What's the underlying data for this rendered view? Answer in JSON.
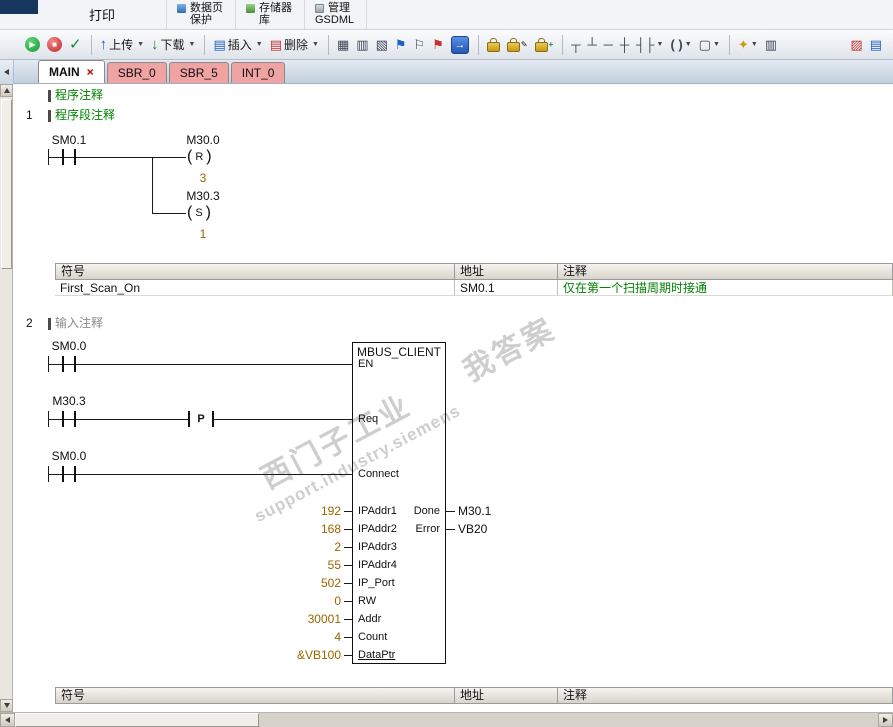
{
  "ribbon": {
    "print": "打印",
    "data_page": "数据页",
    "protect": "保护",
    "memory": "存储器",
    "library": "库",
    "manage": "管理",
    "gsdml": "GSDML"
  },
  "toolbar": {
    "upload": "上传",
    "download": "下载",
    "insert": "插入",
    "delete": "删除"
  },
  "icons": {
    "run": "▶",
    "stop": "■",
    "compile": "✓",
    "up_arrow": "↑",
    "down_arrow": "↓",
    "caret": "▼",
    "grid": "▤",
    "grid2": "▦",
    "grid3": "▥",
    "apply": "▧",
    "flag": "⚑",
    "flag_off": "⚐",
    "status_arrow": "→",
    "branch_down": "┬",
    "branch_up": "┴",
    "line_h": "─",
    "cross": "┼",
    "contact": "┤├",
    "coil": "( )",
    "box": "▢",
    "wand": "✦",
    "pencil": "✎",
    "plus": "+",
    "chart": "▨",
    "close_x": "×",
    "scroll_up": "▲",
    "scroll_left": "◄"
  },
  "tabs": [
    {
      "label": "MAIN",
      "close": "×"
    },
    {
      "label": "SBR_0"
    },
    {
      "label": "SBR_5"
    },
    {
      "label": "INT_0"
    }
  ],
  "editor": {
    "program_comment": "程序注释",
    "net1": {
      "num": "1",
      "comment": "程序段注释",
      "contact": "SM0.1",
      "coil1": {
        "label": "M30.0",
        "fn": "R",
        "n": "3"
      },
      "coil2": {
        "label": "M30.3",
        "fn": "S",
        "n": "1"
      }
    },
    "table1": {
      "h": {
        "sym": "符号",
        "addr": "地址",
        "cmt": "注释"
      },
      "row": {
        "sym": "First_Scan_On",
        "addr": "SM0.1",
        "cmt": "仅在第一个扫描周期时接通"
      }
    },
    "net2": {
      "num": "2",
      "comment": "输入注释",
      "rung1": "SM0.0",
      "rung2": "M30.3",
      "p": "P",
      "rung3": "SM0.0",
      "block": {
        "title": "MBUS_CLIENT",
        "en": "EN",
        "req": "Req",
        "connect": "Connect",
        "in": [
          {
            "v": "192",
            "n": "IPAddr1"
          },
          {
            "v": "168",
            "n": "IPAddr2"
          },
          {
            "v": "2",
            "n": "IPAddr3"
          },
          {
            "v": "55",
            "n": "IPAddr4"
          },
          {
            "v": "502",
            "n": "IP_Port"
          },
          {
            "v": "0",
            "n": "RW"
          },
          {
            "v": "30001",
            "n": "Addr"
          },
          {
            "v": "4",
            "n": "Count"
          },
          {
            "v": "&VB100",
            "n": "DataPtr"
          }
        ],
        "out": [
          {
            "n": "Done",
            "v": "M30.1"
          },
          {
            "n": "Error",
            "v": "VB20"
          }
        ]
      }
    },
    "table2": {
      "h": {
        "sym": "符号",
        "addr": "地址",
        "cmt": "注释"
      }
    },
    "watermark": {
      "brand": "西门子工业",
      "extra": "我答案",
      "url": "support.industry.siemens"
    }
  }
}
